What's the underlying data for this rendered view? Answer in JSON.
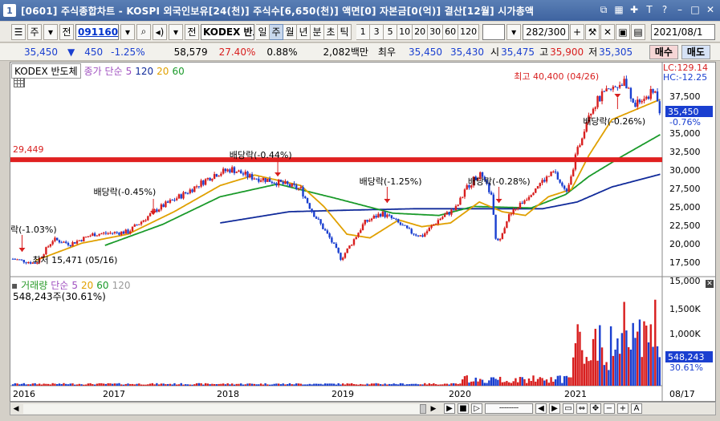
{
  "window": {
    "number": "1",
    "title": "[0601] 주식종합차트 - KOSPI 외국인보유[24(천)] 주식수[6,650(천)] 액면[0] 자본금[0(억)] 결산[12월] 시가총액"
  },
  "toolbar": {
    "market": "주",
    "mode": "전",
    "code": "091160",
    "name_icon": "전",
    "name": "KODEX 반도",
    "periods": [
      "일",
      "주",
      "월",
      "년",
      "분",
      "초",
      "틱"
    ],
    "active_period": "주",
    "numbers": [
      "1",
      "3",
      "5",
      "10",
      "20",
      "30",
      "60",
      "120"
    ],
    "count_current": "282",
    "count_total": "/300",
    "date": "2021/08/1"
  },
  "quote": {
    "price": "35,450",
    "change": "450",
    "change_pct": "-1.25%",
    "volume": "58,579",
    "vol_ratio": "27.40%",
    "turnover": "0.88%",
    "amount": "2,082백만",
    "rank": "최우",
    "bid1": "35,450",
    "bid2": "35,430",
    "open_label": "시",
    "open": "35,475",
    "high_label": "고",
    "high": "35,900",
    "low_label": "저",
    "low": "35,305",
    "buy": "매수",
    "sell": "매도"
  },
  "legend": {
    "name": "KODEX 반도체",
    "price_label": "종가 단순",
    "ma": [
      "5",
      "120",
      "20",
      "60"
    ],
    "vol_label": "거래량",
    "vol_ma_label": "단순",
    "vol_ma": [
      "5",
      "20",
      "60",
      "120"
    ],
    "vol_value": "548,243주(30.61%)"
  },
  "indicators": {
    "lc": "LC:129.14",
    "hc": "HC:-12.25",
    "current_price": "35,450",
    "current_pct": "-0.76%",
    "current_vol": "548,243",
    "current_vol_pct": "30.61%"
  },
  "annotations": {
    "high": "최고 40,400 (04/26)",
    "low": "최저 15,471 (05/16)",
    "hline_value": "29,449",
    "dividends": [
      "락(-1.03%)",
      "배당락(-0.45%)",
      "배당락(-0.44%)",
      "배당락(-1.25%)",
      "배당락(-0.28%)",
      "배당락(-0.26%)"
    ]
  },
  "colors": {
    "up": "#d81e1e",
    "down": "#1a3fd0",
    "ma5": "#a050c0",
    "ma20": "#e0a000",
    "ma60": "#1a9a2a",
    "ma120": "#102a9a",
    "hline": "#e02020"
  },
  "axis": {
    "price_ticks": [
      "37,500",
      "35,000",
      "32,500",
      "30,000",
      "27,500",
      "25,000",
      "22,500",
      "20,000",
      "17,500",
      "15,000"
    ],
    "vol_ticks": [
      "1,500K",
      "1,000K"
    ],
    "years": [
      "2016",
      "2017",
      "2018",
      "2019",
      "2020",
      "2021"
    ],
    "last_date": "08/17"
  },
  "chart_data": {
    "type": "line",
    "x": [
      "2016",
      "2017",
      "2018",
      "2019",
      "2020",
      "2021"
    ],
    "ylim": [
      14000,
      41000
    ],
    "price_knots": [
      [
        2016.0,
        16200
      ],
      [
        2016.1,
        15900
      ],
      [
        2016.2,
        15600
      ],
      [
        2016.35,
        18800
      ],
      [
        2016.5,
        18200
      ],
      [
        2016.7,
        19500
      ],
      [
        2017.0,
        19800
      ],
      [
        2017.25,
        22800
      ],
      [
        2017.5,
        25000
      ],
      [
        2017.75,
        27500
      ],
      [
        2017.9,
        28200
      ],
      [
        2018.05,
        27200
      ],
      [
        2018.2,
        26800
      ],
      [
        2018.35,
        26200
      ],
      [
        2018.5,
        25500
      ],
      [
        2018.6,
        22500
      ],
      [
        2018.75,
        19000
      ],
      [
        2018.85,
        16200
      ],
      [
        2018.95,
        18500
      ],
      [
        2019.05,
        21000
      ],
      [
        2019.2,
        22300
      ],
      [
        2019.3,
        21500
      ],
      [
        2019.45,
        19800
      ],
      [
        2019.55,
        19200
      ],
      [
        2019.7,
        21500
      ],
      [
        2019.85,
        23000
      ],
      [
        2019.95,
        26000
      ],
      [
        2020.05,
        27500
      ],
      [
        2020.15,
        25000
      ],
      [
        2020.2,
        18000
      ],
      [
        2020.3,
        21800
      ],
      [
        2020.45,
        24200
      ],
      [
        2020.55,
        26000
      ],
      [
        2020.7,
        27800
      ],
      [
        2020.8,
        25000
      ],
      [
        2020.9,
        30500
      ],
      [
        2021.0,
        35800
      ],
      [
        2021.1,
        37800
      ],
      [
        2021.2,
        38800
      ],
      [
        2021.3,
        40000
      ],
      [
        2021.4,
        36800
      ],
      [
        2021.5,
        37900
      ],
      [
        2021.58,
        38600
      ],
      [
        2021.62,
        35450
      ]
    ],
    "ma60_knots": [
      [
        2016.8,
        18000
      ],
      [
        2017.3,
        20800
      ],
      [
        2017.8,
        24500
      ],
      [
        2018.3,
        26200
      ],
      [
        2018.8,
        24300
      ],
      [
        2019.3,
        22300
      ],
      [
        2019.7,
        22000
      ],
      [
        2020.0,
        23200
      ],
      [
        2020.5,
        23000
      ],
      [
        2020.8,
        24800
      ],
      [
        2021.0,
        27200
      ],
      [
        2021.3,
        30000
      ],
      [
        2021.62,
        32800
      ]
    ],
    "ma120_knots": [
      [
        2017.8,
        21000
      ],
      [
        2018.4,
        22500
      ],
      [
        2018.9,
        22700
      ],
      [
        2019.5,
        22900
      ],
      [
        2020.0,
        22900
      ],
      [
        2020.6,
        22900
      ],
      [
        2020.9,
        23800
      ],
      [
        2021.2,
        25800
      ],
      [
        2021.62,
        27500
      ]
    ],
    "ma20_knots": [
      [
        2016.2,
        16000
      ],
      [
        2016.6,
        18300
      ],
      [
        2017.0,
        19500
      ],
      [
        2017.4,
        22500
      ],
      [
        2017.8,
        26000
      ],
      [
        2018.1,
        27400
      ],
      [
        2018.5,
        26000
      ],
      [
        2018.7,
        23200
      ],
      [
        2018.9,
        19500
      ],
      [
        2019.1,
        19000
      ],
      [
        2019.35,
        21400
      ],
      [
        2019.55,
        20500
      ],
      [
        2019.8,
        21000
      ],
      [
        2020.05,
        23800
      ],
      [
        2020.25,
        22500
      ],
      [
        2020.45,
        22000
      ],
      [
        2020.65,
        24500
      ],
      [
        2020.85,
        25500
      ],
      [
        2021.0,
        30000
      ],
      [
        2021.2,
        34800
      ],
      [
        2021.62,
        37500
      ]
    ],
    "hline": 29449
  }
}
